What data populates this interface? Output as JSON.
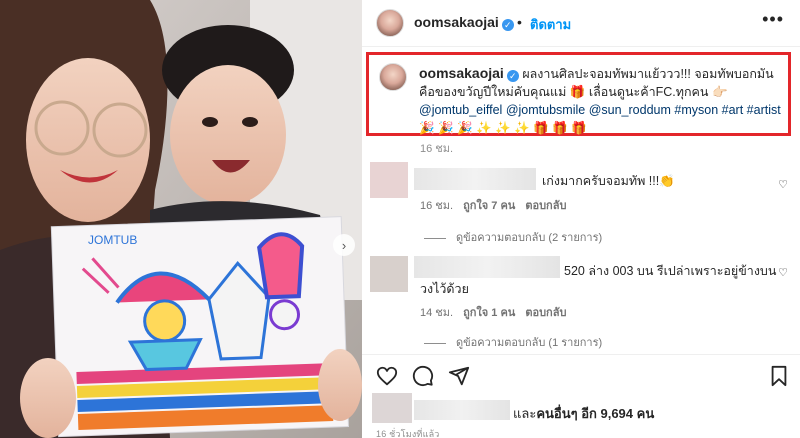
{
  "post": {
    "username": "oomsakaojai",
    "verified_icon": "verified-badge-icon",
    "separator": "•",
    "follow_label": "ติดตาม",
    "more_icon": "more-options-icon",
    "caption": {
      "username": "oomsakaojai",
      "text_1": "ผลงานศิลปะจอมทัพมาแย้ววว!!! จอมทัพบอกมันคือของขวัญปีใหม่คับคุณแม่",
      "emoji_gift": "🎁",
      "text_2": "เลื่อนดูนะค้าFC.ทุกคน",
      "emoji_point": "👉🏻",
      "mention_1": "@jomtub_eiffel",
      "mention_2": "@jomtubsmile",
      "mention_3": "@sun_roddum",
      "hashtag_1": "#myson",
      "hashtag_2": "#art",
      "hashtag_3": "#artist",
      "emoji_tail": "🎉 🎉 🎉 ✨ ✨ ✨ 🎁 🎁 🎁"
    },
    "caption_time": "16 ชม."
  },
  "comments": [
    {
      "text": "เก่งมากครับจอมทัพ !!!👏",
      "time": "16 ชม.",
      "likes": "ถูกใจ 7 คน",
      "reply_label": "ตอบกลับ",
      "view_replies": "ดูข้อความตอบกลับ (2 รายการ)"
    },
    {
      "text_line1": "520 ล่าง 003 บน รีเปล่าเพราะอยู่ข้างบน",
      "text_line2": "วงไว้ด้วย",
      "time": "14 ชม.",
      "likes": "ถูกใจ 1 คน",
      "reply_label": "ตอบกลับ",
      "view_replies": "ดูข้อความตอบกลับ (1 รายการ)"
    }
  ],
  "actions": {
    "like_icon": "heart-icon",
    "comment_icon": "comment-icon",
    "share_icon": "share-icon",
    "save_icon": "bookmark-icon"
  },
  "likes_summary": {
    "prefix": "และ",
    "bold": "คนอื่นๆ อีก 9,694 คน"
  },
  "posted_time": "16 ชั่วโมงที่แล้ว",
  "photo": {
    "drawing_label": "JOMTUB",
    "next_icon": "chevron-right-icon"
  },
  "colors": {
    "highlight_box": "#e3262a",
    "link": "#0095f6",
    "tag": "#00376b"
  }
}
